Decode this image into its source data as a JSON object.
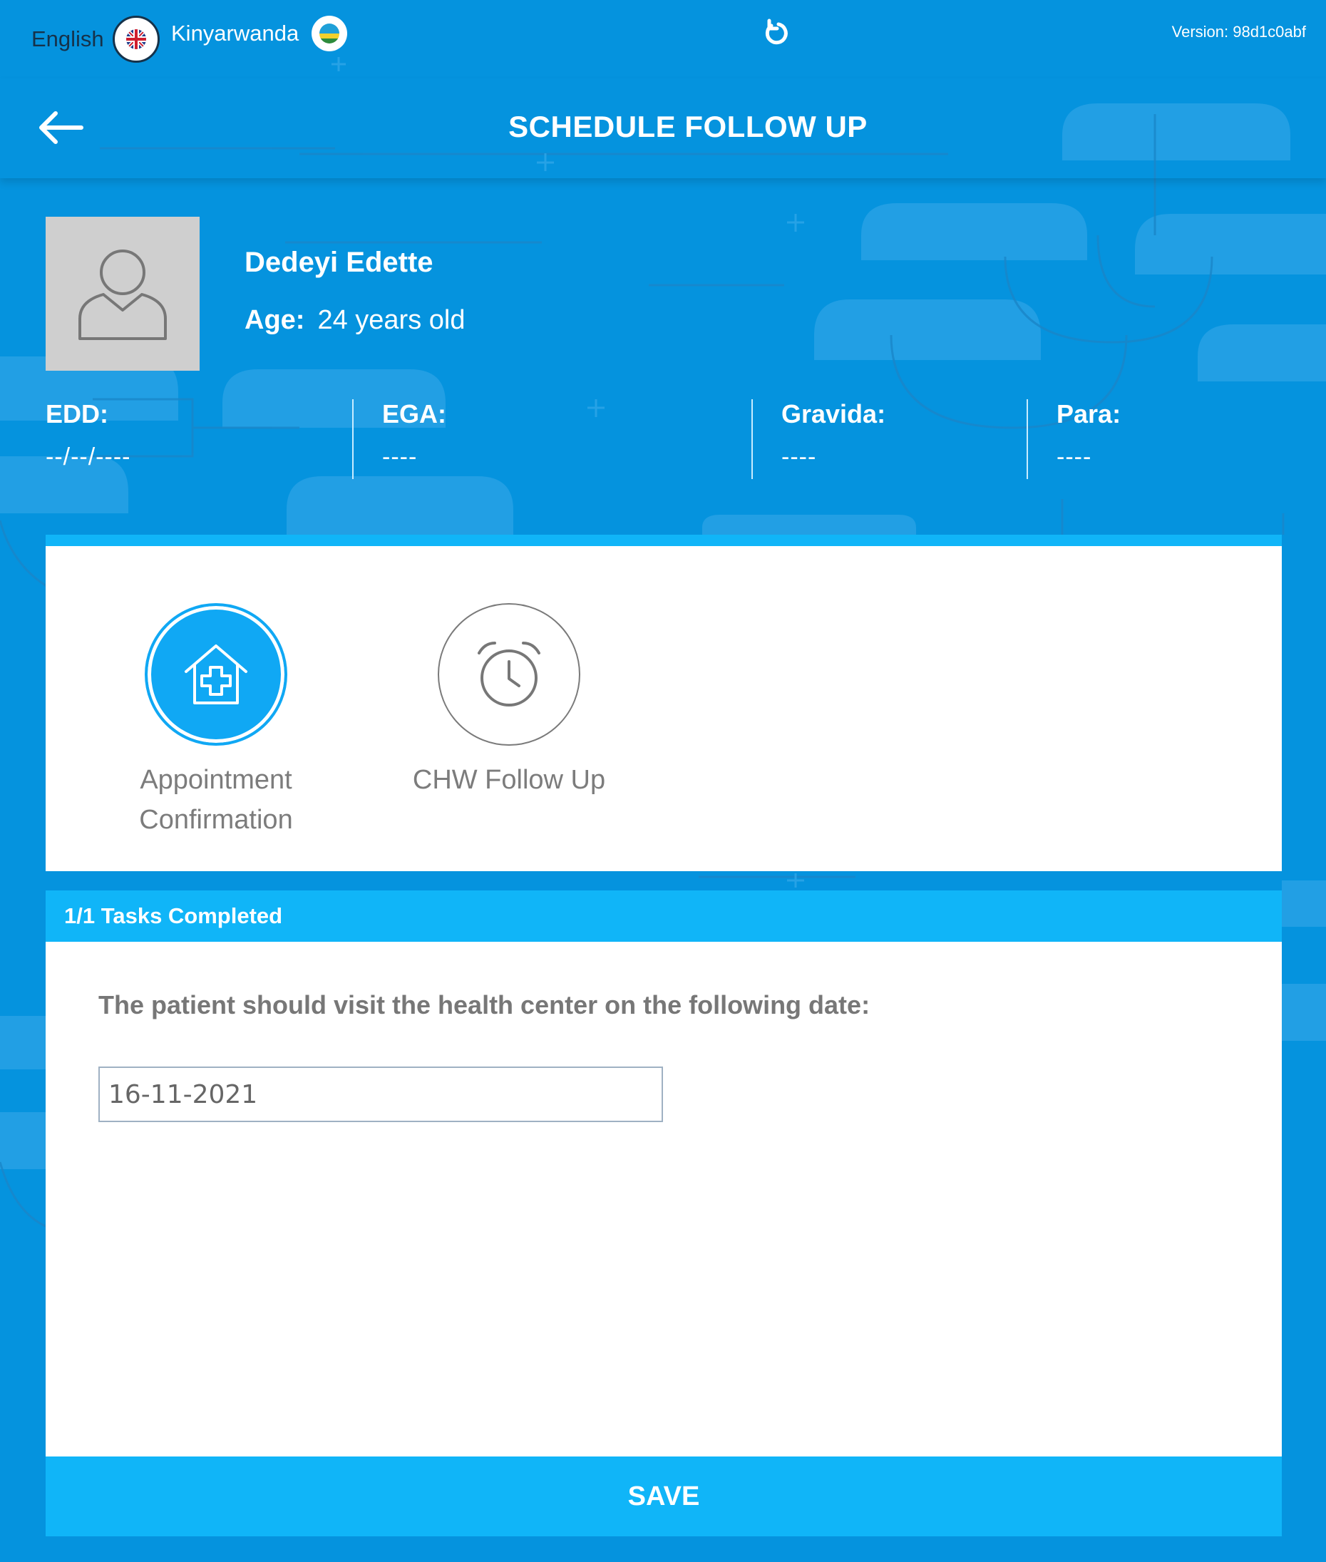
{
  "topbar": {
    "languages": [
      {
        "label": "English",
        "flag": "uk-flag-icon",
        "active": true
      },
      {
        "label": "Kinyarwanda",
        "flag": "rwanda-flag-icon",
        "active": false
      }
    ],
    "refresh_icon": "refresh-icon",
    "version": "Version: 98d1c0abf"
  },
  "header": {
    "back_icon": "arrow-left-icon",
    "title": "SCHEDULE FOLLOW UP"
  },
  "patient": {
    "name": "Dedeyi Edette",
    "age_label": "Age:",
    "age_value": "24 years old",
    "avatar_icon": "user-avatar-icon"
  },
  "stats": [
    {
      "label": "EDD:",
      "value": "--/--/----"
    },
    {
      "label": "EGA:",
      "value": "----"
    },
    {
      "label": "Gravida:",
      "value": "----"
    },
    {
      "label": "Para:",
      "value": "----"
    }
  ],
  "tasks": [
    {
      "label_line1": "Appointment",
      "label_line2": "Confirmation",
      "icon": "house-medical-icon",
      "active": true
    },
    {
      "label_line1": "CHW Follow Up",
      "label_line2": "",
      "icon": "alarm-clock-icon",
      "active": false
    }
  ],
  "form": {
    "progress": "1/1 Tasks Completed",
    "question": "The patient should visit the health center on the following date:",
    "date_value": "16-11-2021",
    "save_label": "SAVE"
  },
  "colors": {
    "background": "#0593de",
    "accent": "#10b5f8",
    "active_circle": "#10a8f4"
  }
}
